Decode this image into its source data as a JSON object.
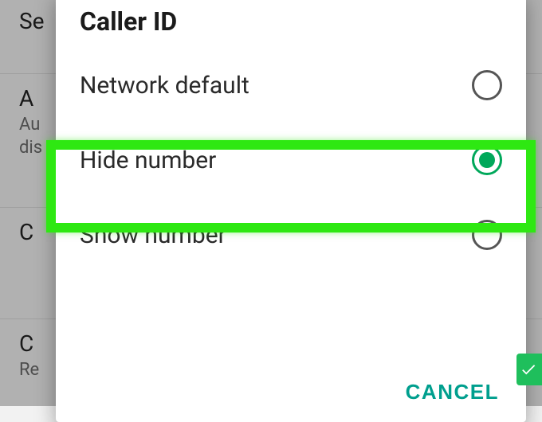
{
  "background": {
    "search_label": "Se",
    "rows": [
      {
        "title": "A",
        "sub1": "Au",
        "sub2": "dis"
      },
      {
        "title": "C"
      },
      {
        "title": "C",
        "sub1": "Re"
      }
    ]
  },
  "dialog": {
    "title": "Caller ID",
    "options": [
      {
        "label": "Network default",
        "selected": false
      },
      {
        "label": "Hide number",
        "selected": true
      },
      {
        "label": "Show number",
        "selected": false
      }
    ],
    "cancel_label": "CANCEL"
  }
}
